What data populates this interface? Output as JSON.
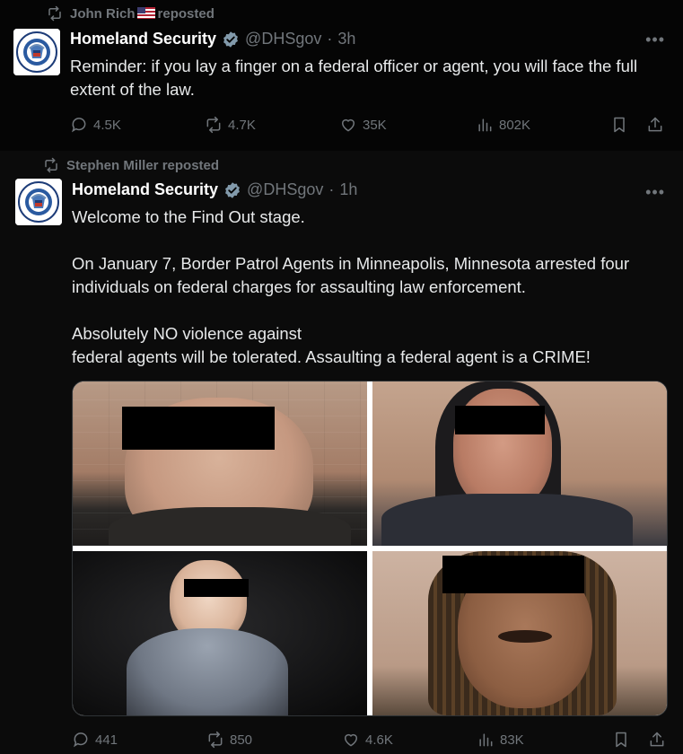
{
  "colors": {
    "background": "#000000",
    "text": "#e7e9ea",
    "muted": "#71767b",
    "verified_badge": "#829aab",
    "censor_bar": "#000000"
  },
  "tweets": [
    {
      "repost": {
        "icon": "repost-icon",
        "user": "John Rich",
        "flag": "us-flag-emoji",
        "suffix": "reposted"
      },
      "author": {
        "name": "Homeland Security",
        "handle": "@DHSgov",
        "time": "3h",
        "avatar": "dhs-seal"
      },
      "text_paragraphs": [
        "Reminder: if you lay a finger on a federal officer or agent, you will face the full extent of the law."
      ],
      "stats": {
        "replies": "4.5K",
        "reposts": "4.7K",
        "likes": "35K",
        "views": "802K"
      }
    },
    {
      "repost": {
        "icon": "repost-icon",
        "user": "Stephen Miller",
        "suffix": "reposted"
      },
      "author": {
        "name": "Homeland Security",
        "handle": "@DHSgov",
        "time": "1h",
        "avatar": "dhs-seal"
      },
      "text_paragraphs": [
        "Welcome to the Find Out stage.",
        "On January 7, Border Patrol Agents in Minneapolis, Minnesota arrested four individuals on federal charges for assaulting law enforcement.",
        "Absolutely NO violence against\nfederal agents will be tolerated. Assaulting a federal agent is a CRIME!"
      ],
      "media": {
        "type": "photo-grid",
        "count": 4,
        "faces_censored": true
      },
      "stats": {
        "replies": "441",
        "reposts": "850",
        "likes": "4.6K",
        "views": "83K"
      }
    }
  ]
}
